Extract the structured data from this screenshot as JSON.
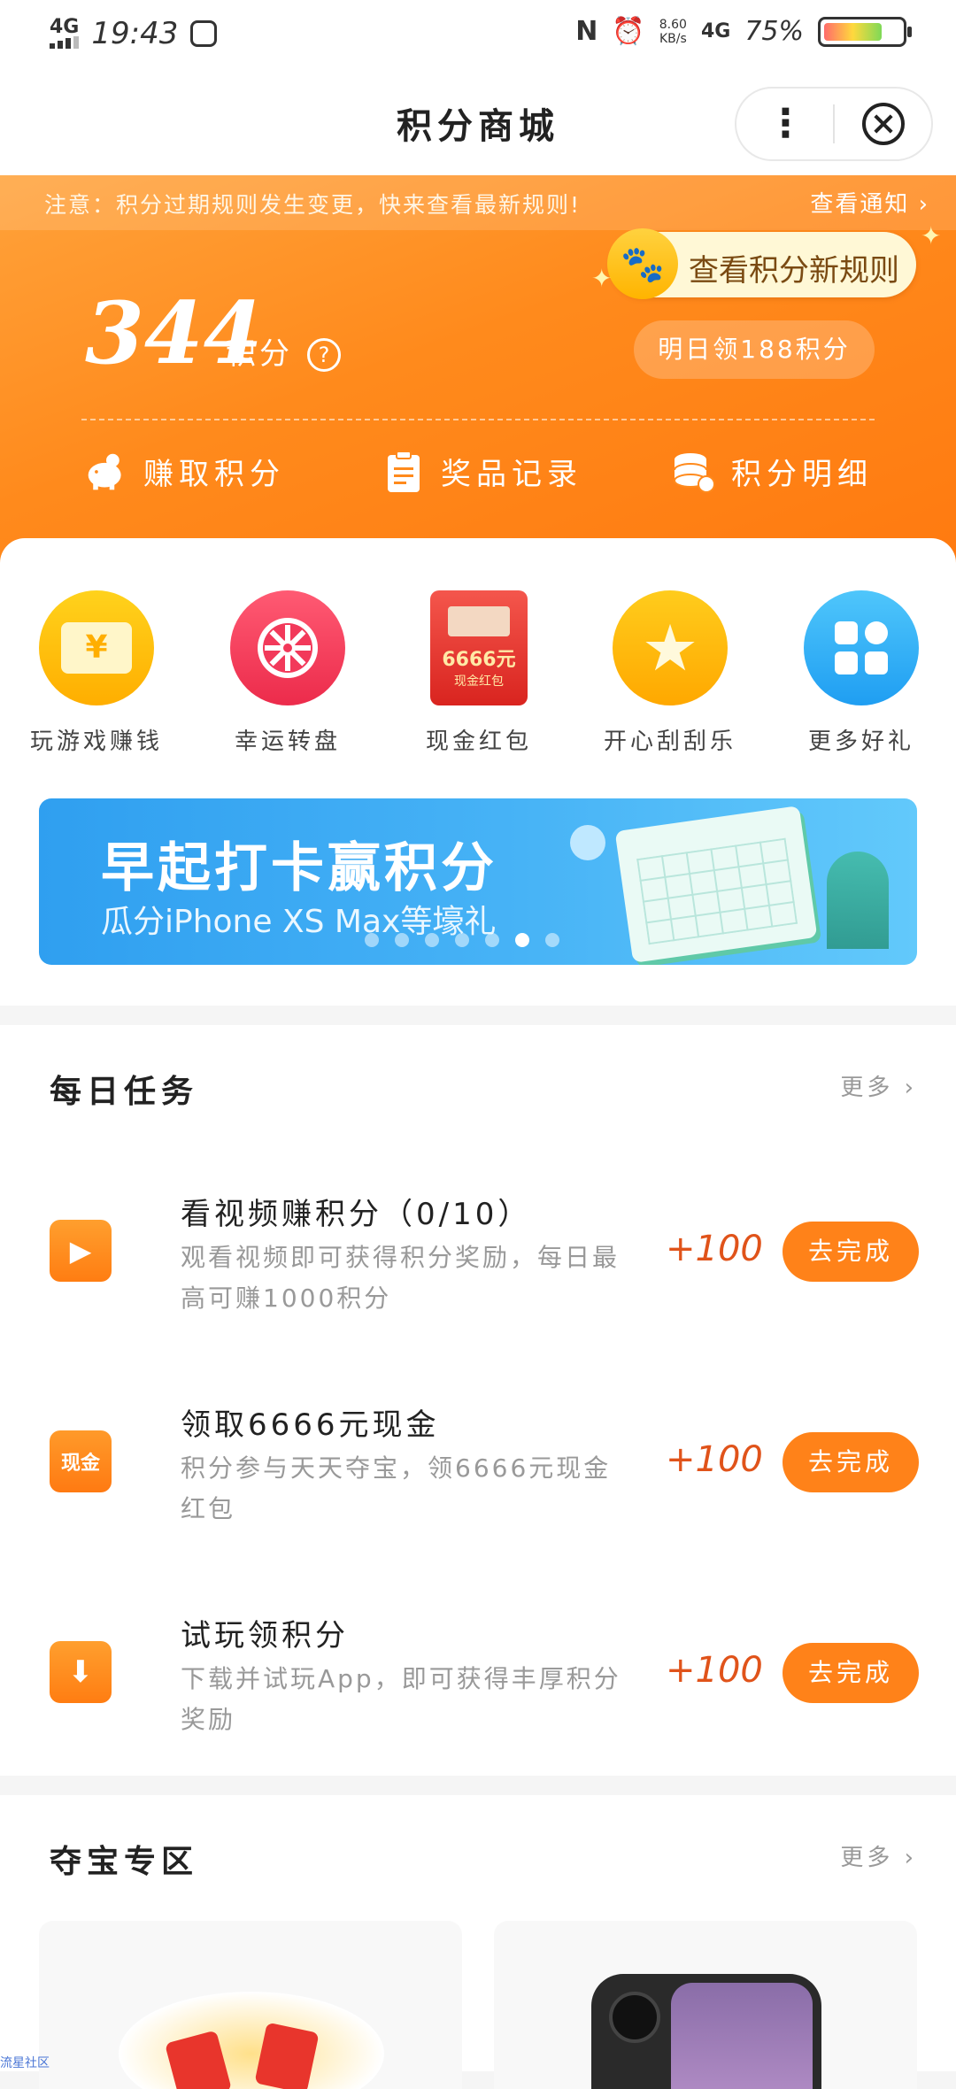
{
  "status_bar": {
    "network": "4G",
    "time": "19:43",
    "speed_top": "8.60",
    "speed_bottom": "KB/s",
    "network_right": "4G",
    "battery": "75%",
    "battery_level": 0.75
  },
  "header": {
    "title": "积分商城",
    "more_glyph": "⋮"
  },
  "notice": {
    "text": "注意：积分过期规则发生变更，快来查看最新规则!",
    "link": "查看通知"
  },
  "rule_badge": {
    "text": "查看积分新规则"
  },
  "points": {
    "value": "344",
    "unit": "积分",
    "help": "?",
    "tomorrow": "明日领188积分"
  },
  "quick_actions": [
    {
      "icon": "piggy-bank-icon",
      "label": "赚取积分"
    },
    {
      "icon": "clipboard-icon",
      "label": "奖品记录"
    },
    {
      "icon": "coins-icon",
      "label": "积分明细"
    }
  ],
  "grid": [
    {
      "icon": "wallet-icon",
      "glyph": "¥",
      "label": "玩游戏赚钱",
      "color": "#ffb300"
    },
    {
      "icon": "wheel-icon",
      "glyph": "✺",
      "label": "幸运转盘",
      "color": "#f2395a"
    },
    {
      "icon": "red-envelope-icon",
      "glyph": "6666元",
      "sub": "现金红包",
      "label": "现金红包",
      "color": "#e8302a"
    },
    {
      "icon": "star-icon",
      "glyph": "★",
      "label": "开心刮刮乐",
      "color": "#ffb300"
    },
    {
      "icon": "apps-icon",
      "glyph": "◆",
      "label": "更多好礼",
      "color": "#2fb1f5"
    }
  ],
  "banner": {
    "title": "早起打卡赢积分",
    "subtitle": "瓜分iPhone XS Max等壕礼",
    "dots": 7,
    "active_dot": 5
  },
  "daily": {
    "title": "每日任务",
    "more": "更多",
    "tasks": [
      {
        "icon": "video-icon",
        "icon_text": "▶",
        "title": "看视频赚积分（0/10）",
        "desc": "观看视频即可获得积分奖励，每日最高可赚1000积分",
        "points": "+100",
        "button": "去完成"
      },
      {
        "icon": "cash-icon",
        "icon_text": "现金",
        "title": "领取6666元现金",
        "desc": "积分参与天天夺宝，领6666元现金红包",
        "points": "+100",
        "button": "去完成"
      },
      {
        "icon": "download-icon",
        "icon_text": "⬇",
        "title": "试玩领积分",
        "desc": "下载并试玩App，即可获得丰厚积分奖励",
        "points": "+100",
        "button": "去完成"
      }
    ]
  },
  "treasure": {
    "title": "夺宝专区",
    "more": "更多"
  },
  "watermark": "流星社区"
}
